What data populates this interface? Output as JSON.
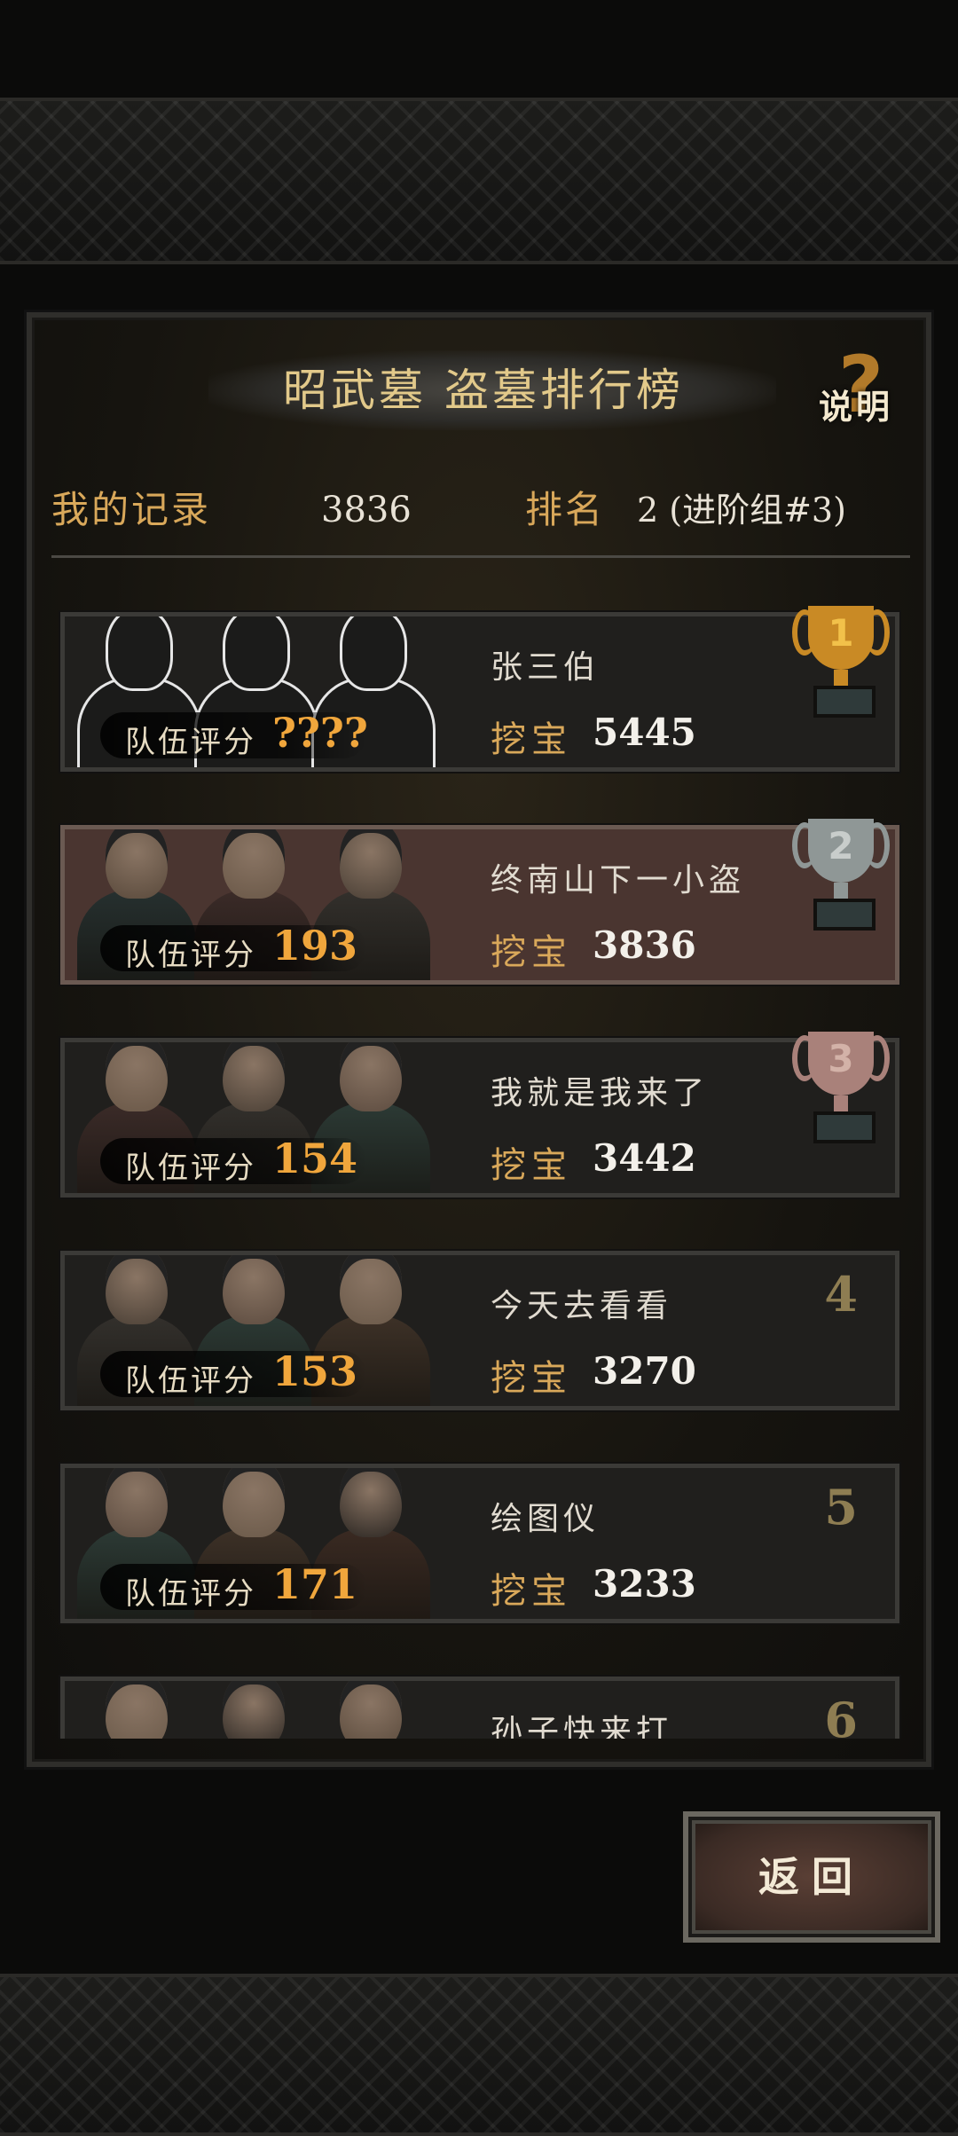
{
  "header": {
    "title": "昭武墓 盗墓排行榜",
    "help_label": "说明",
    "help_icon": "question-mark-icon"
  },
  "my_record": {
    "label": "我的记录",
    "value": "3836",
    "rank_label": "排名",
    "rank_value": "2 (进阶组#3)"
  },
  "common": {
    "team_score_label": "队伍评分",
    "dig_label": "挖宝"
  },
  "leaderboard": [
    {
      "rank": "1",
      "name": "张三伯",
      "team_score": "????",
      "dig_score": "5445",
      "trophy": "gold-trophy-icon"
    },
    {
      "rank": "2",
      "name": "终南山下一小盗",
      "team_score": "193",
      "dig_score": "3836",
      "trophy": "silver-trophy-icon",
      "is_me": true
    },
    {
      "rank": "3",
      "name": "我就是我来了",
      "team_score": "154",
      "dig_score": "3442",
      "trophy": "bronze-trophy-icon"
    },
    {
      "rank": "4",
      "name": "今天去看看",
      "team_score": "153",
      "dig_score": "3270"
    },
    {
      "rank": "5",
      "name": "绘图仪",
      "team_score": "171",
      "dig_score": "3233"
    },
    {
      "rank": "6",
      "name": "孙子快来打",
      "team_score": "",
      "dig_score": ""
    }
  ],
  "footer": {
    "back_label": "返回"
  },
  "colors": {
    "accent_gold": "#d9a85a",
    "score_orange": "#f0a63c",
    "highlight_row": "#4a3530"
  }
}
